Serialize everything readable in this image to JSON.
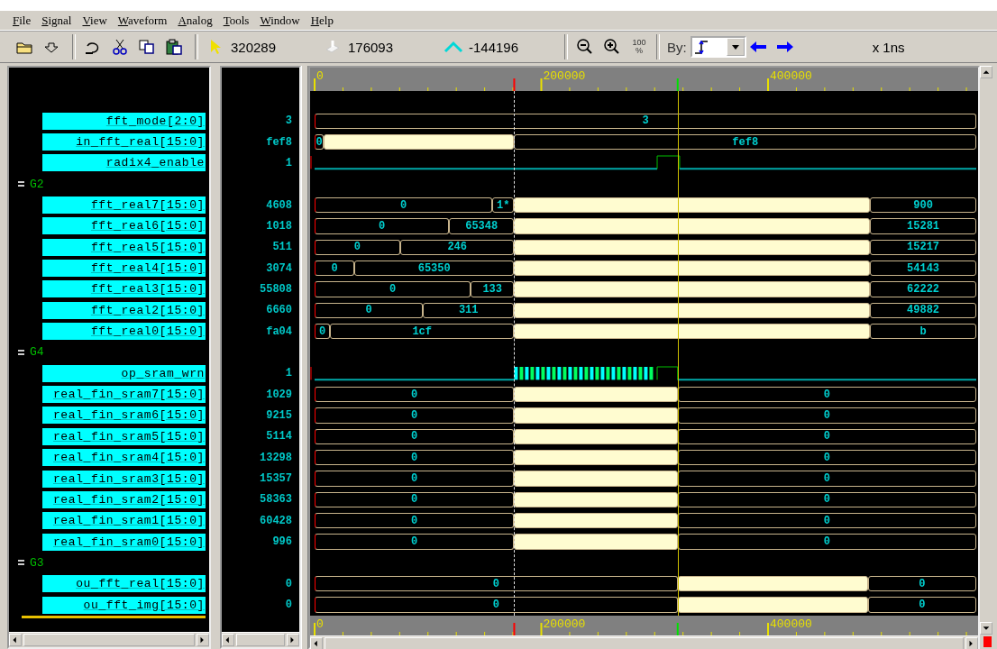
{
  "menu": [
    "File",
    "Signal",
    "View",
    "Waveform",
    "Analog",
    "Tools",
    "Window",
    "Help"
  ],
  "toolbar": {
    "cursor": "320289",
    "marker": "176093",
    "delta": "-144196",
    "zoom_fit": [
      "100",
      "%"
    ],
    "by_label": "By:",
    "unit": "x 1ns"
  },
  "ruler_top": {
    "labels": [
      "0",
      "200000",
      "400000"
    ]
  },
  "rows": [
    {
      "kind": "signal",
      "name": "fft_mode[2:0]",
      "value": "3",
      "selected": true,
      "wave": [
        {
          "kind": "bus",
          "value": "3"
        }
      ]
    },
    {
      "kind": "signal",
      "name": "in_fft_real[15:0]",
      "value": "fef8",
      "selected": true,
      "wave": [
        {
          "kind": "bus",
          "value": "0"
        },
        {
          "kind": "fill"
        },
        {
          "kind": "bus",
          "value": "fef8"
        }
      ]
    },
    {
      "kind": "signal",
      "name": "radix4_enable",
      "value": "1",
      "selected": true,
      "wave": [
        {
          "kind": "low"
        },
        {
          "kind": "high"
        },
        {
          "kind": "low"
        }
      ]
    },
    {
      "kind": "group",
      "name": "G2"
    },
    {
      "kind": "signal",
      "name": "fft_real7[15:0]",
      "value": "4608",
      "selected": true,
      "wave": [
        {
          "kind": "bus",
          "value": "0"
        },
        {
          "kind": "bus",
          "value": "1*"
        },
        {
          "kind": "fill"
        },
        {
          "kind": "bus",
          "value": "900"
        }
      ]
    },
    {
      "kind": "signal",
      "name": "fft_real6[15:0]",
      "value": "1018",
      "selected": true,
      "wave": [
        {
          "kind": "bus",
          "value": "0"
        },
        {
          "kind": "bus",
          "value": "65348"
        },
        {
          "kind": "fill"
        },
        {
          "kind": "bus",
          "value": "15281"
        }
      ]
    },
    {
      "kind": "signal",
      "name": "fft_real5[15:0]",
      "value": "511",
      "selected": true,
      "wave": [
        {
          "kind": "bus",
          "value": "0"
        },
        {
          "kind": "bus",
          "value": "246"
        },
        {
          "kind": "fill"
        },
        {
          "kind": "bus",
          "value": "15217"
        }
      ]
    },
    {
      "kind": "signal",
      "name": "fft_real4[15:0]",
      "value": "3074",
      "selected": true,
      "wave": [
        {
          "kind": "bus",
          "value": "0"
        },
        {
          "kind": "bus",
          "value": "65350"
        },
        {
          "kind": "fill"
        },
        {
          "kind": "bus",
          "value": "54143"
        }
      ]
    },
    {
      "kind": "signal",
      "name": "fft_real3[15:0]",
      "value": "55808",
      "selected": true,
      "wave": [
        {
          "kind": "bus",
          "value": "0"
        },
        {
          "kind": "bus",
          "value": "133"
        },
        {
          "kind": "fill"
        },
        {
          "kind": "bus",
          "value": "62222"
        }
      ]
    },
    {
      "kind": "signal",
      "name": "fft_real2[15:0]",
      "value": "6660",
      "selected": true,
      "wave": [
        {
          "kind": "bus",
          "value": "0"
        },
        {
          "kind": "bus",
          "value": "311"
        },
        {
          "kind": "fill"
        },
        {
          "kind": "bus",
          "value": "49882"
        }
      ]
    },
    {
      "kind": "signal",
      "name": "fft_real0[15:0]",
      "value": "fa04",
      "selected": true,
      "wave": [
        {
          "kind": "bus",
          "value": "0"
        },
        {
          "kind": "bus",
          "value": "1cf"
        },
        {
          "kind": "fill"
        },
        {
          "kind": "bus",
          "value": "b"
        }
      ]
    },
    {
      "kind": "group",
      "name": "G4"
    },
    {
      "kind": "signal",
      "name": "op_sram_wrn",
      "value": "1",
      "selected": true,
      "wave": [
        {
          "kind": "low"
        },
        {
          "kind": "toggle"
        },
        {
          "kind": "high"
        },
        {
          "kind": "low"
        }
      ]
    },
    {
      "kind": "signal",
      "name": "real_fin_sram7[15:0]",
      "value": "1029",
      "selected": true,
      "wave": [
        {
          "kind": "bus",
          "value": "0"
        },
        {
          "kind": "fill"
        },
        {
          "kind": "bus",
          "value": "0"
        }
      ]
    },
    {
      "kind": "signal",
      "name": "real_fin_sram6[15:0]",
      "value": "9215",
      "selected": true,
      "wave": [
        {
          "kind": "bus",
          "value": "0"
        },
        {
          "kind": "fill"
        },
        {
          "kind": "bus",
          "value": "0"
        }
      ]
    },
    {
      "kind": "signal",
      "name": "real_fin_sram5[15:0]",
      "value": "5114",
      "selected": true,
      "wave": [
        {
          "kind": "bus",
          "value": "0"
        },
        {
          "kind": "fill"
        },
        {
          "kind": "bus",
          "value": "0"
        }
      ]
    },
    {
      "kind": "signal",
      "name": "real_fin_sram4[15:0]",
      "value": "13298",
      "selected": true,
      "wave": [
        {
          "kind": "bus",
          "value": "0"
        },
        {
          "kind": "fill"
        },
        {
          "kind": "bus",
          "value": "0"
        }
      ]
    },
    {
      "kind": "signal",
      "name": "real_fin_sram3[15:0]",
      "value": "15357",
      "selected": true,
      "wave": [
        {
          "kind": "bus",
          "value": "0"
        },
        {
          "kind": "fill"
        },
        {
          "kind": "bus",
          "value": "0"
        }
      ]
    },
    {
      "kind": "signal",
      "name": "real_fin_sram2[15:0]",
      "value": "58363",
      "selected": true,
      "wave": [
        {
          "kind": "bus",
          "value": "0"
        },
        {
          "kind": "fill"
        },
        {
          "kind": "bus",
          "value": "0"
        }
      ]
    },
    {
      "kind": "signal",
      "name": "real_fin_sram1[15:0]",
      "value": "60428",
      "selected": true,
      "wave": [
        {
          "kind": "bus",
          "value": "0"
        },
        {
          "kind": "fill"
        },
        {
          "kind": "bus",
          "value": "0"
        }
      ]
    },
    {
      "kind": "signal",
      "name": "real_fin_sram0[15:0]",
      "value": "996",
      "selected": true,
      "wave": [
        {
          "kind": "bus",
          "value": "0"
        },
        {
          "kind": "fill"
        },
        {
          "kind": "bus",
          "value": "0"
        }
      ]
    },
    {
      "kind": "group",
      "name": "G3"
    },
    {
      "kind": "signal",
      "name": "ou_fft_real[15:0]",
      "value": "0",
      "selected": true,
      "wave": [
        {
          "kind": "bus",
          "value": "0"
        },
        {
          "kind": "fill"
        },
        {
          "kind": "bus",
          "value": "0"
        }
      ]
    },
    {
      "kind": "signal",
      "name": "ou_fft_img[15:0]",
      "value": "0",
      "selected": true,
      "wave": [
        {
          "kind": "bus",
          "value": "0"
        },
        {
          "kind": "fill"
        },
        {
          "kind": "bus",
          "value": "0"
        }
      ]
    }
  ],
  "ruler_bottom": {
    "labels": [
      "0",
      "200000",
      "400000"
    ]
  }
}
